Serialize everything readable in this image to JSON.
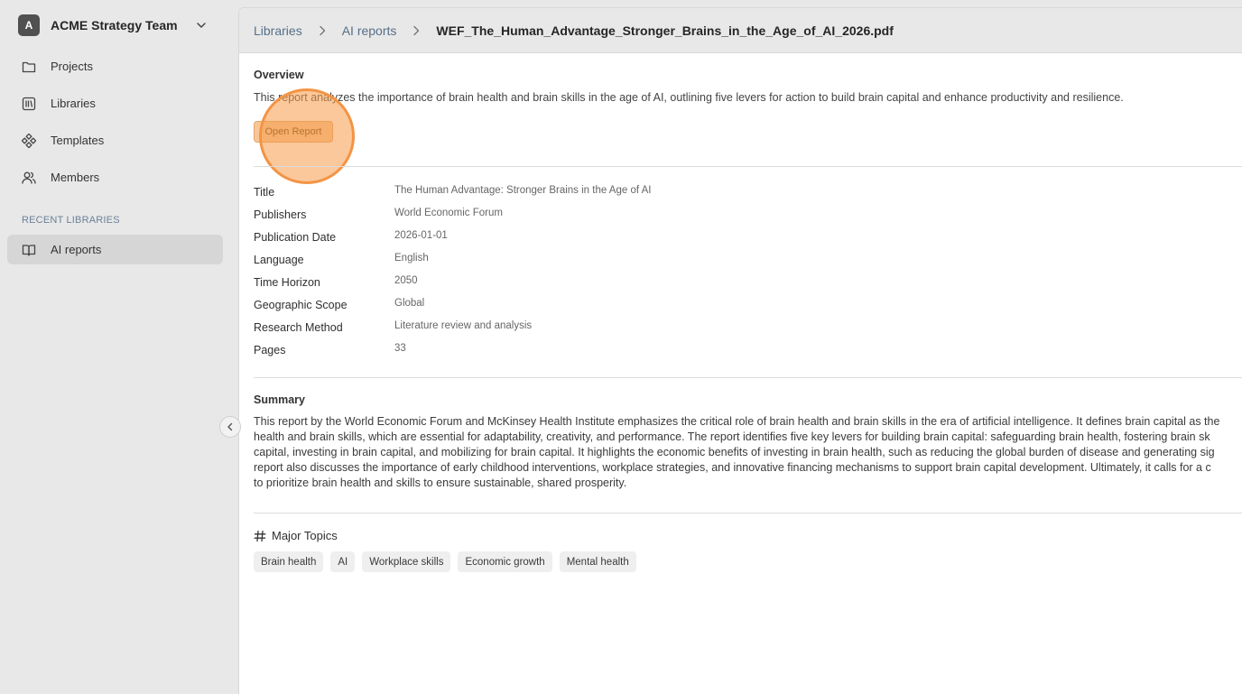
{
  "sidebar": {
    "team": {
      "initial": "A",
      "name": "ACME Strategy Team"
    },
    "nav": [
      {
        "label": "Projects",
        "icon": "folder-icon"
      },
      {
        "label": "Libraries",
        "icon": "library-icon"
      },
      {
        "label": "Templates",
        "icon": "templates-icon"
      },
      {
        "label": "Members",
        "icon": "members-icon"
      }
    ],
    "recent_header": "RECENT LIBRARIES",
    "recent": [
      {
        "label": "AI reports",
        "icon": "book-icon"
      }
    ]
  },
  "breadcrumb": {
    "root": "Libraries",
    "parent": "AI reports",
    "current": "WEF_The_Human_Advantage_Stronger_Brains_in_the_Age_of_AI_2026.pdf"
  },
  "overview": {
    "title": "Overview",
    "text": "This report analyzes the importance of brain health and brain skills in the age of AI, outlining five levers for action to build brain capital and enhance productivity and resilience.",
    "button": "Open Report"
  },
  "metadata": [
    {
      "key": "Title",
      "value": "The Human Advantage: Stronger Brains in the Age of AI"
    },
    {
      "key": "Publishers",
      "value": "World Economic Forum"
    },
    {
      "key": "Publication Date",
      "value": "2026-01-01"
    },
    {
      "key": "Language",
      "value": "English"
    },
    {
      "key": "Time Horizon",
      "value": "2050"
    },
    {
      "key": "Geographic Scope",
      "value": "Global"
    },
    {
      "key": "Research Method",
      "value": "Literature review and analysis"
    },
    {
      "key": "Pages",
      "value": "33"
    }
  ],
  "summary": {
    "title": "Summary",
    "lines": [
      "This report by the World Economic Forum and McKinsey Health Institute emphasizes the critical role of brain health and brain skills in the era of artificial intelligence. It defines brain capital as the",
      "health and brain skills, which are essential for adaptability, creativity, and performance. The report identifies five key levers for building brain capital: safeguarding brain health, fostering brain sk",
      "capital, investing in brain capital, and mobilizing for brain capital. It highlights the economic benefits of investing in brain health, such as reducing the global burden of disease and generating sig",
      "report also discusses the importance of early childhood interventions, workplace strategies, and innovative financing mechanisms to support brain capital development. Ultimately, it calls for a c",
      "to prioritize brain health and skills to ensure sustainable, shared prosperity."
    ]
  },
  "topics": {
    "title": "Major Topics",
    "items": [
      "Brain health",
      "AI",
      "Workplace skills",
      "Economic growth",
      "Mental health"
    ]
  }
}
